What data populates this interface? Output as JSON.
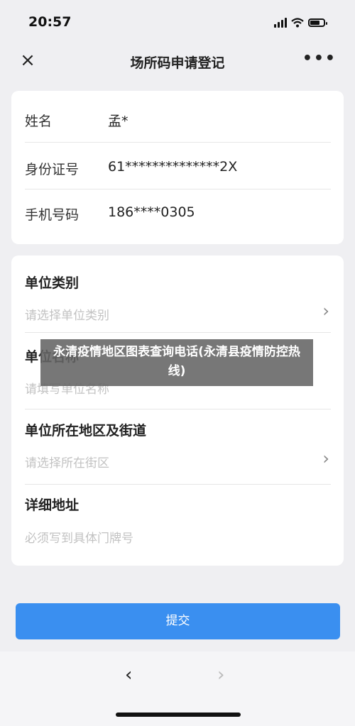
{
  "status": {
    "time": "20:57"
  },
  "nav": {
    "title": "场所码申请登记",
    "close_icon": "×",
    "more_icon": "•••"
  },
  "identity": {
    "rows": [
      {
        "label": "姓名",
        "value": "孟*"
      },
      {
        "label": "身份证号",
        "value": "61**************2X"
      },
      {
        "label": "手机号码",
        "value": "186****0305"
      }
    ]
  },
  "form": {
    "unit_type": {
      "label": "单位类别",
      "placeholder": "请选择单位类别"
    },
    "unit_name": {
      "label": "单位名称",
      "placeholder": "请填写单位名称"
    },
    "unit_area": {
      "label": "单位所在地区及街道",
      "placeholder": "请选择所在街区"
    },
    "address": {
      "label": "详细地址",
      "placeholder": "必须写到具体门牌号"
    }
  },
  "overlay_caption": "永清疫情地区图表查询电话(永清县疫情防控热线)",
  "submit_label": "提交",
  "bottom_nav": {
    "back": "‹",
    "forward": "›"
  },
  "colors": {
    "primary": "#3a8ff0",
    "background": "#efeff2"
  }
}
